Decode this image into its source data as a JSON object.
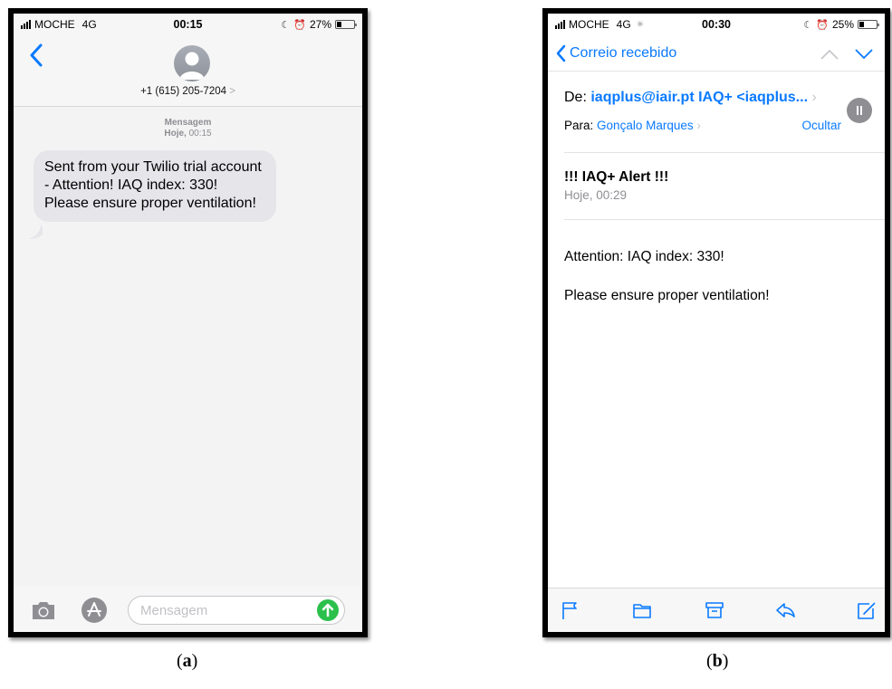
{
  "phone_a": {
    "status": {
      "carrier": "MOCHE",
      "network": "4G",
      "time": "00:15",
      "battery": "27%",
      "battery_level": 0.27
    },
    "contact": {
      "number": "+1 (615) 205-7204",
      "chevron": ">"
    },
    "message_meta": {
      "label": "Mensagem",
      "day": "Hoje,",
      "time": "00:15"
    },
    "message_text": "Sent from your Twilio trial account - Attention! IAQ index: 330! Please ensure proper ventilation!",
    "input_placeholder": "Mensagem",
    "icons": [
      "chevron-left-icon",
      "avatar-icon",
      "camera-icon",
      "app-store-icon",
      "send-arrow-icon"
    ],
    "accent_color": "#2bc04c"
  },
  "phone_b": {
    "status": {
      "carrier": "MOCHE",
      "network": "4G",
      "time": "00:30",
      "battery": "25%",
      "battery_level": 0.25
    },
    "nav": {
      "back_label": "Correio recebido"
    },
    "from_label": "De:",
    "from_value": "iaqplus@iair.pt IAQ+ <iaqplus...",
    "to_label": "Para:",
    "to_value": "Gonçalo Marques",
    "hide_label": "Ocultar",
    "subject": "!!! IAQ+ Alert !!!",
    "date": "Hoje, 00:29",
    "body_line1": "Attention: IAQ index: 330!",
    "body_line2": "Please ensure proper ventilation!",
    "icons": [
      "chevron-up-icon",
      "chevron-down-icon",
      "pause-icon",
      "flag-icon",
      "folder-icon",
      "archive-icon",
      "reply-icon",
      "compose-icon"
    ],
    "accent_color": "#0a7aff"
  },
  "captions": {
    "a": "(a)",
    "b": "(b)"
  }
}
